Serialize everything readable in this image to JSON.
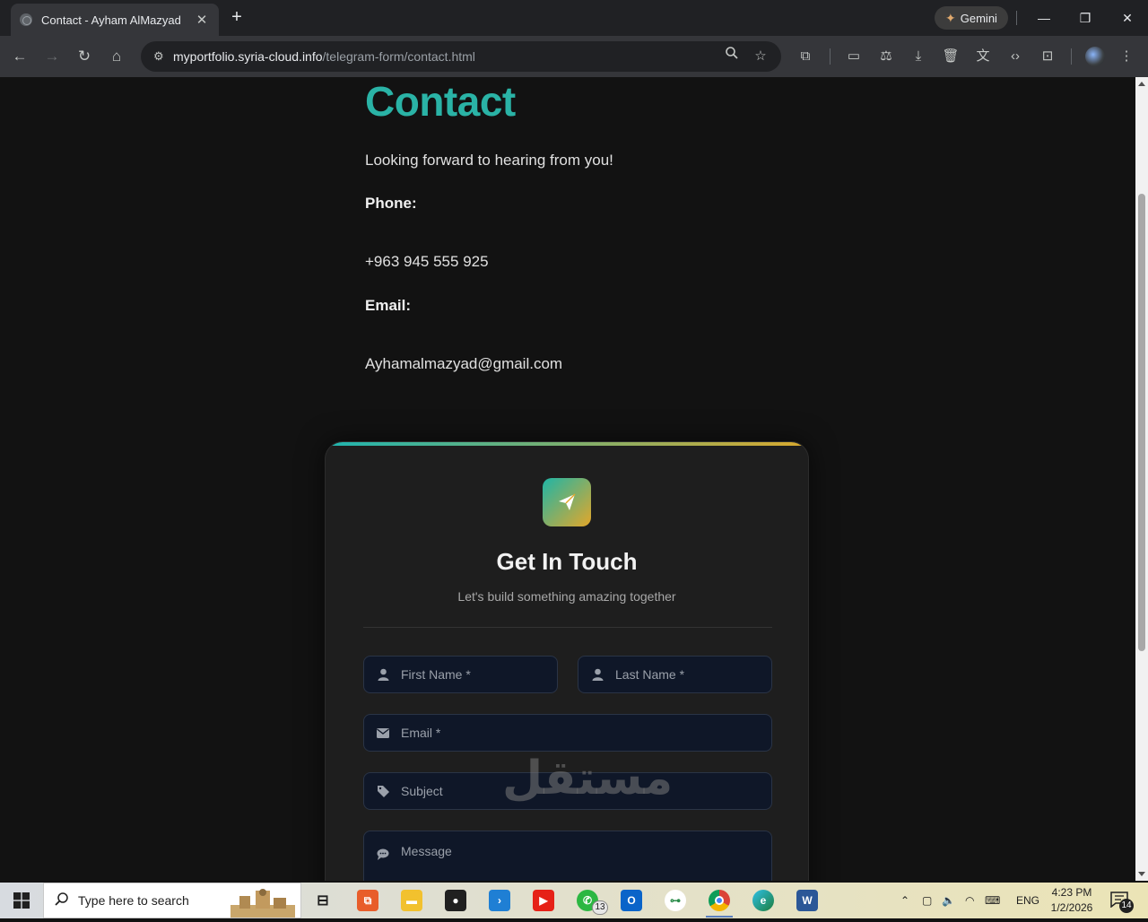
{
  "browser": {
    "tab_title": "Contact - Ayham AlMazyad",
    "gemini_label": "Gemini",
    "url_host": "myportfolio.syria-cloud.info",
    "url_path": "/telegram-form/contact.html"
  },
  "page": {
    "title": "Contact",
    "lead": "Looking forward to hearing from you!",
    "phone_label": "Phone:",
    "phone_value": "+963 945 555 925",
    "email_label": "Email:",
    "email_value": "Ayhamalmazyad@gmail.com"
  },
  "form": {
    "heading": "Get In Touch",
    "subheading": "Let's build something amazing together",
    "first_name_placeholder": "First Name *",
    "last_name_placeholder": "Last Name *",
    "email_placeholder": "Email *",
    "subject_placeholder": "Subject",
    "message_placeholder": "Message"
  },
  "watermark": "مستقل",
  "taskbar": {
    "search_placeholder": "Type here to search",
    "whatsapp_badge": "13",
    "language": "ENG",
    "time": "4:23 PM",
    "date": "1/2/2026",
    "notifications": "14"
  },
  "colors": {
    "accent_teal": "#2ab3a6",
    "accent_gold": "#d9a92e",
    "input_bg": "#0f1728"
  }
}
